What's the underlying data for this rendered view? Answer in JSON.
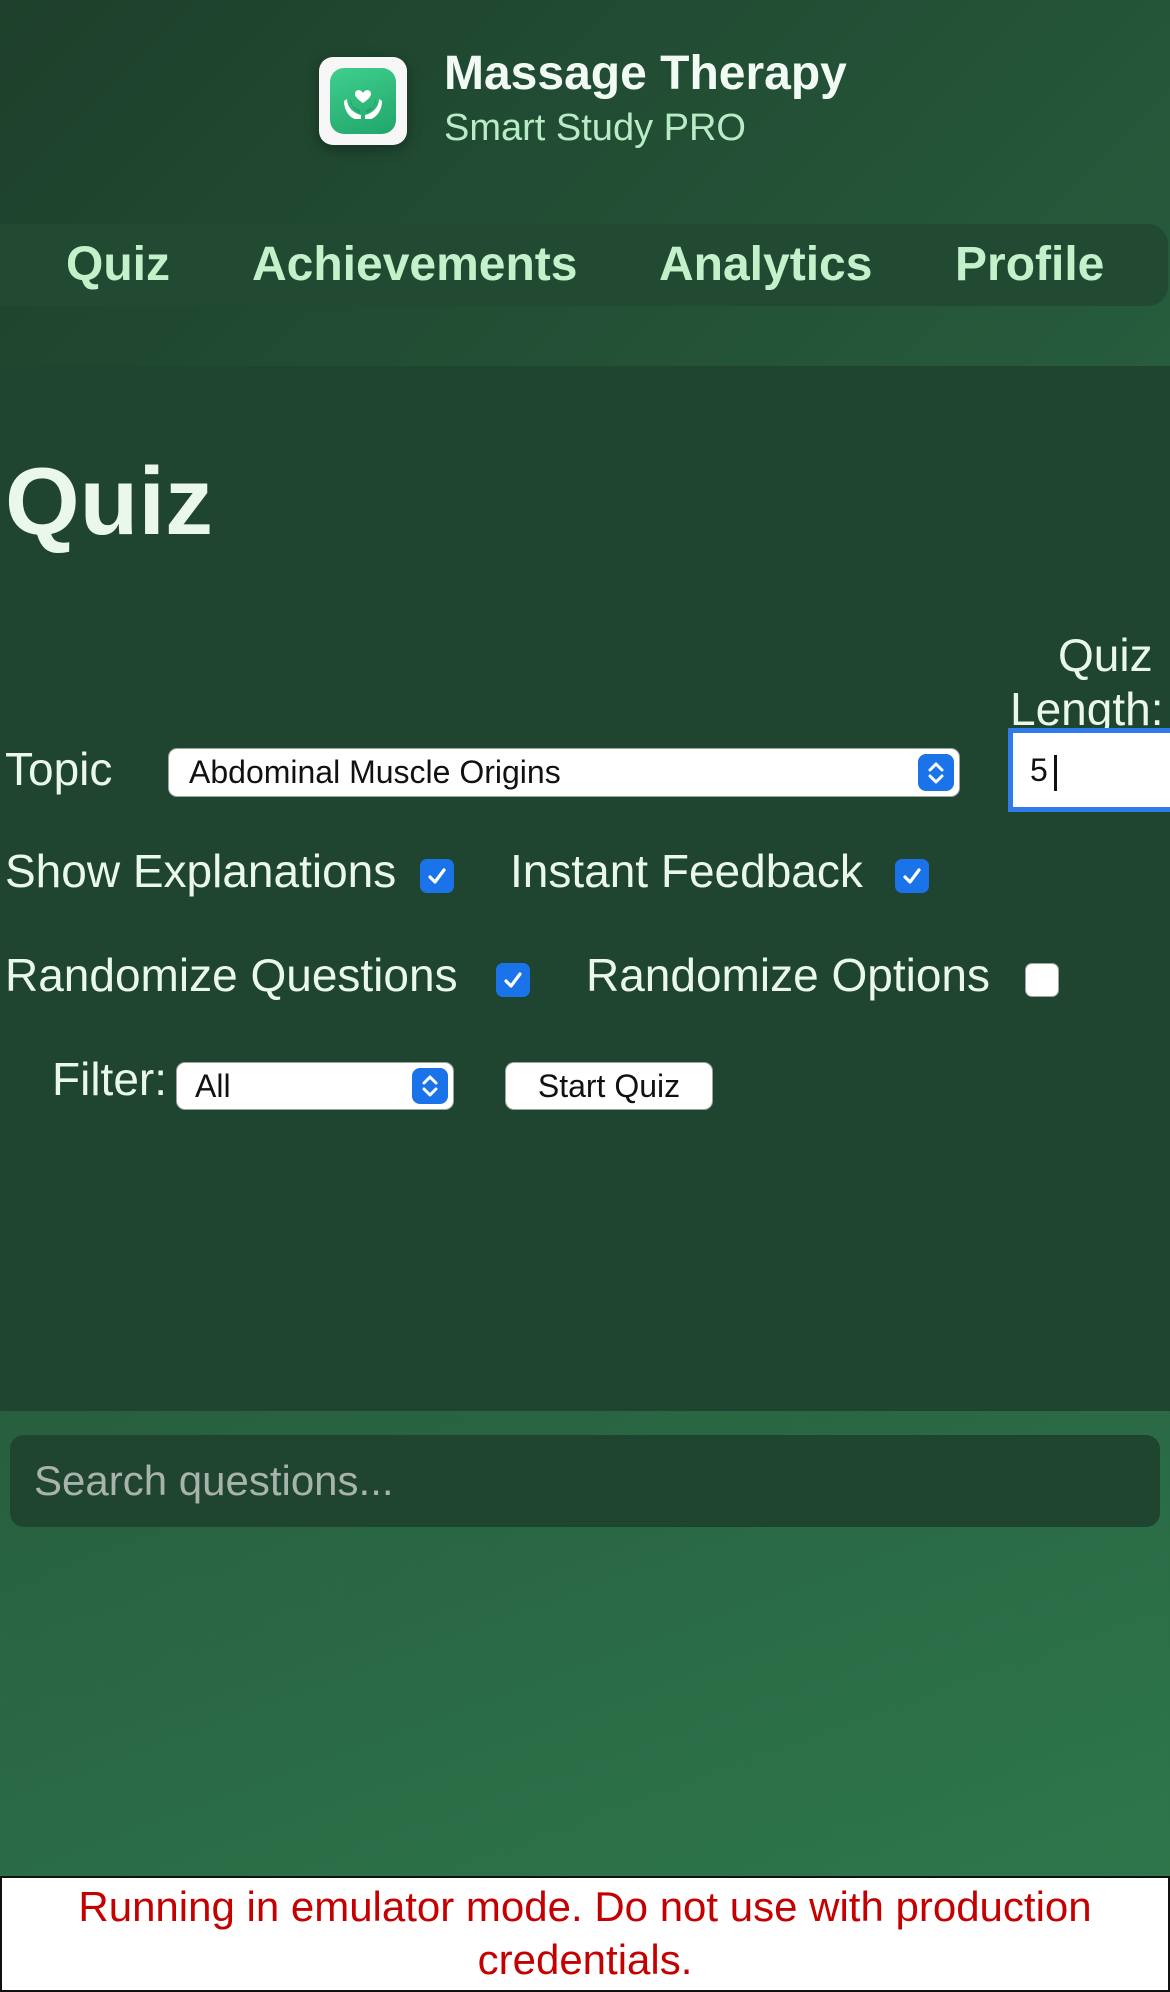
{
  "header": {
    "title": "Massage Therapy",
    "subtitle": "Smart Study PRO",
    "icon": "hands-holding-heart-icon"
  },
  "nav": [
    {
      "label": "Quiz"
    },
    {
      "label": "Achievements"
    },
    {
      "label": "Analytics"
    },
    {
      "label": "Profile"
    }
  ],
  "main": {
    "title": "Quiz",
    "topic_label": "Topic",
    "topic_value": "Abdominal Muscle Origins",
    "quiz_length_label_line1": "Quiz",
    "quiz_length_label_line2": "Length:",
    "quiz_length_value": "5",
    "options": [
      {
        "label": "Show Explanations",
        "checked": true
      },
      {
        "label": "Instant Feedback",
        "checked": true
      },
      {
        "label": "Randomize Questions",
        "checked": true
      },
      {
        "label": "Randomize Options",
        "checked": false
      }
    ],
    "filter_label": "Filter:",
    "filter_value": "All",
    "start_button": "Start Quiz"
  },
  "search": {
    "placeholder": "Search questions..."
  },
  "warning": {
    "line1": "Running in emulator mode. Do not use with production",
    "line2": "credentials."
  },
  "colors": {
    "accent": "#1a73e8",
    "nav_text": "#c4f1c9",
    "warning_text": "#c40000"
  }
}
